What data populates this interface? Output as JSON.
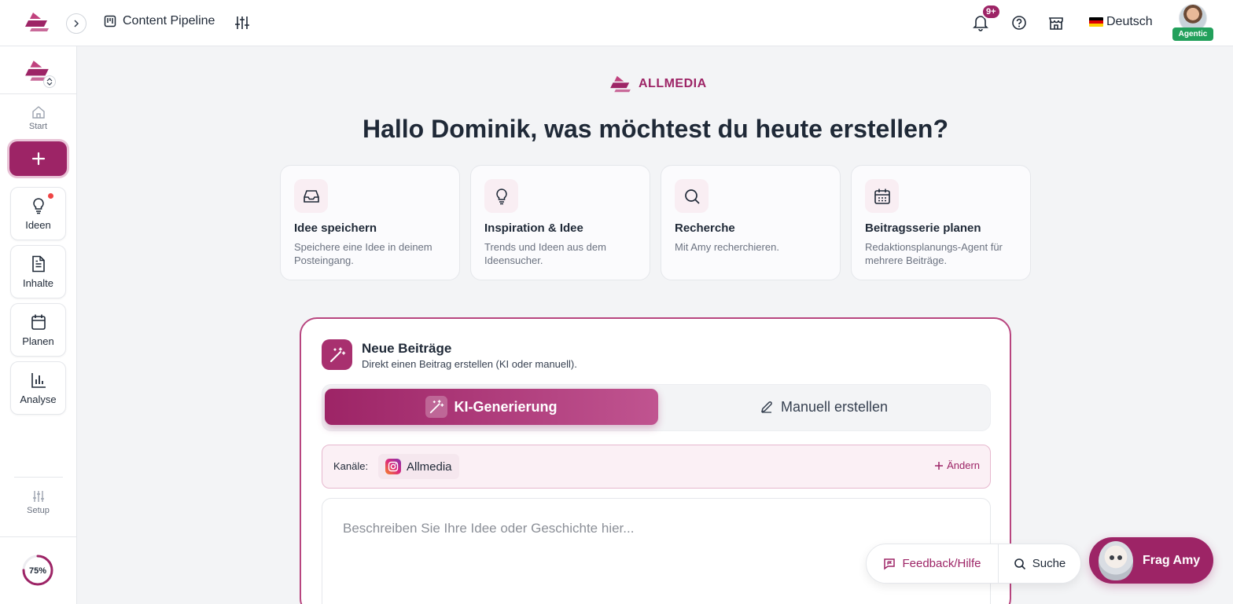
{
  "topbar": {
    "title": "Content Pipeline",
    "notification_badge": "9+",
    "language": "Deutsch",
    "user_badge": "Agentic"
  },
  "sidebar": {
    "start_label": "Start",
    "items": [
      {
        "label": "Ideen",
        "icon": "lightbulb-icon"
      },
      {
        "label": "Inhalte",
        "icon": "document-icon"
      },
      {
        "label": "Planen",
        "icon": "calendar-icon"
      },
      {
        "label": "Analyse",
        "icon": "bar-chart-icon"
      }
    ],
    "setup_label": "Setup",
    "progress_label": "75%",
    "progress_value": 0.75
  },
  "main": {
    "brand": "ALLMEDIA",
    "greeting": "Hallo Dominik, was möchtest du heute erstellen?",
    "quick_actions": [
      {
        "title": "Idee speichern",
        "desc": "Speichere eine Idee in deinem Posteingang.",
        "icon": "inbox-icon"
      },
      {
        "title": "Inspiration & Idee",
        "desc": "Trends und Ideen aus dem Ideensucher.",
        "icon": "lightbulb-icon"
      },
      {
        "title": "Recherche",
        "desc": "Mit Amy recherchieren.",
        "icon": "search-icon"
      },
      {
        "title": "Beitragsserie planen",
        "desc": "Redaktionsplanungs-Agent für mehrere Beiträge.",
        "icon": "calendar-icon"
      }
    ]
  },
  "panel": {
    "title": "Neue Beiträge",
    "subtitle": "Direkt einen Beitrag erstellen (KI oder manuell).",
    "tab_ai": "KI-Generierung",
    "tab_manual": "Manuell erstellen",
    "channels_label": "Kanäle:",
    "channel_name": "Allmedia",
    "change_label": "Ändern",
    "textarea_placeholder": "Beschreiben Sie Ihre Idee oder Geschichte hier..."
  },
  "floating": {
    "feedback_label": "Feedback/Hilfe",
    "search_label": "Suche",
    "amy_label": "Frag Amy"
  },
  "colors": {
    "brand": "#9d2466",
    "accent_light": "#f9eef3",
    "badge_green": "#22a05b"
  }
}
